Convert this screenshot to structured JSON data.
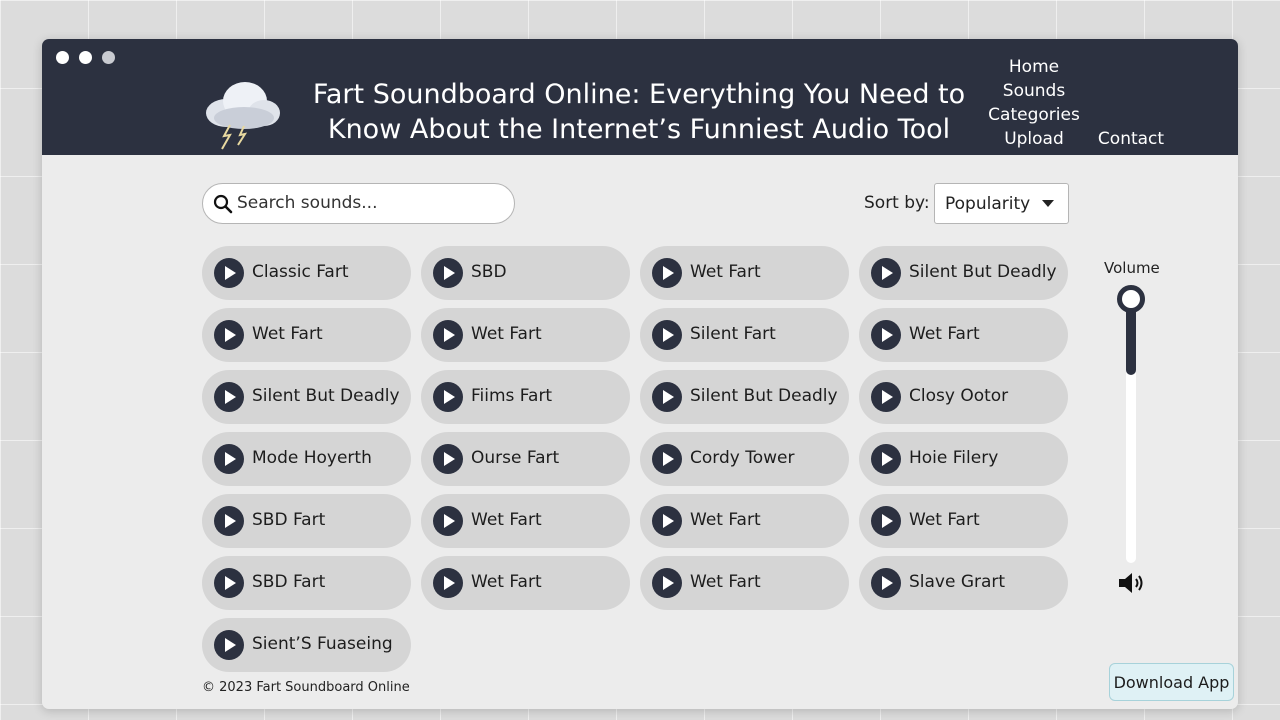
{
  "header": {
    "title": "Fart Soundboard Online: Everything You Need to Know About the Internet’s Funniest Audio Tool",
    "nav": {
      "home": "Home",
      "sounds": "Sounds",
      "categories": "Categories",
      "upload": "Upload",
      "contact": "Contact"
    }
  },
  "toolbar": {
    "search_placeholder": "Search sounds...",
    "sort_label": "Sort by:",
    "sort_value": "Popularity"
  },
  "sounds": [
    "Classic Fart",
    "SBD",
    "Wet Fart",
    "Silent But Deadly",
    "Wet Fart",
    "Wet Fart",
    "Silent Fart",
    "Wet Fart",
    "Silent But Deadly",
    "Fiims Fart",
    "Silent But Deadly",
    "Closy Ootor",
    "Mode Hoyerth",
    "Ourse Fart",
    "Cordy Tower",
    "Hoie Filery",
    "SBD Fart",
    "Wet Fart",
    "Wet Fart",
    "Wet Fart",
    "SBD Fart",
    "Wet Fart",
    "Wet Fart",
    "Slave Grart",
    "Sient’S Fuaseing"
  ],
  "volume": {
    "label": "Volume",
    "level": 0.3
  },
  "footer": {
    "copyright": "© 2023 Fart Soundboard Online"
  },
  "download_label": "Download App",
  "icons": {
    "logo": "storm-cloud-icon",
    "search": "search-icon",
    "play": "play-icon",
    "speaker": "speaker-icon",
    "sort": "chevron-down-icon"
  },
  "colors": {
    "header_bg": "#2c3140",
    "accent": "#2c3140",
    "button_bg": "#d5d5d5",
    "download_bg": "#dff1f5"
  }
}
